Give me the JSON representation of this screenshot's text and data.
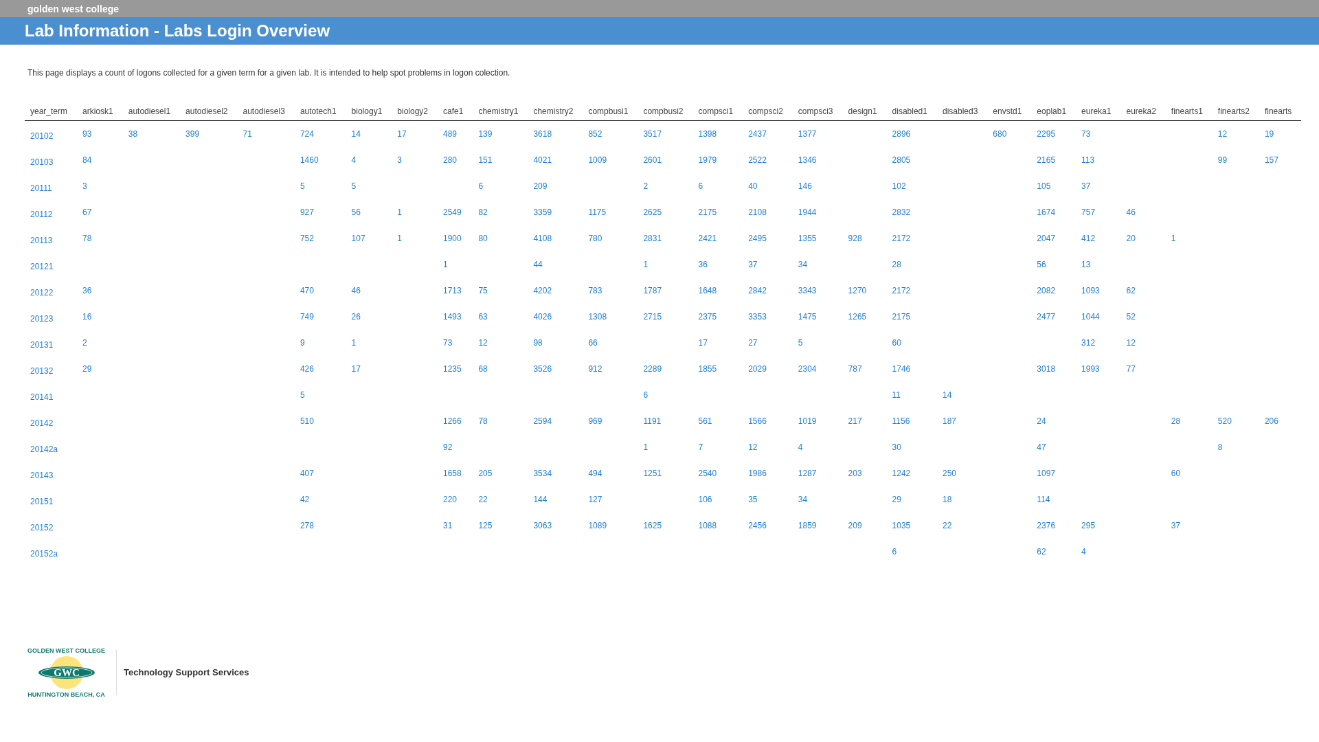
{
  "top_bar": {
    "site_name": "golden west college"
  },
  "header": {
    "title": "Lab Information - Labs Login Overview"
  },
  "intro": "This page displays a count of logons collected for a given term for a given lab. It is intended to help spot problems in logon colection.",
  "table": {
    "columns": [
      "year_term",
      "arkiosk1",
      "autodiesel1",
      "autodiesel2",
      "autodiesel3",
      "autotech1",
      "biology1",
      "biology2",
      "cafe1",
      "chemistry1",
      "chemistry2",
      "compbusi1",
      "compbusi2",
      "compsci1",
      "compsci2",
      "compsci3",
      "design1",
      "disabled1",
      "disabled3",
      "envstd1",
      "eoplab1",
      "eureka1",
      "eureka2",
      "finearts1",
      "finearts2",
      "finearts"
    ],
    "rows": [
      [
        "20102",
        "93",
        "38",
        "399",
        "71",
        "724",
        "14",
        "17",
        "489",
        "139",
        "3618",
        "852",
        "3517",
        "1398",
        "2437",
        "1377",
        null,
        "2896",
        null,
        "680",
        "2295",
        "73",
        null,
        null,
        "12",
        "19"
      ],
      [
        "20103",
        "84",
        null,
        null,
        null,
        "1460",
        "4",
        "3",
        "280",
        "151",
        "4021",
        "1009",
        "2601",
        "1979",
        "2522",
        "1346",
        null,
        "2805",
        null,
        null,
        "2165",
        "113",
        null,
        null,
        "99",
        "157"
      ],
      [
        "20111",
        "3",
        null,
        null,
        null,
        "5",
        "5",
        null,
        null,
        "6",
        "209",
        null,
        "2",
        "6",
        "40",
        "146",
        null,
        "102",
        null,
        null,
        "105",
        "37",
        null,
        null,
        null,
        null
      ],
      [
        "20112",
        "67",
        null,
        null,
        null,
        "927",
        "56",
        "1",
        "2549",
        "82",
        "3359",
        "1175",
        "2625",
        "2175",
        "2108",
        "1944",
        null,
        "2832",
        null,
        null,
        "1674",
        "757",
        "46",
        null,
        null,
        null
      ],
      [
        "20113",
        "78",
        null,
        null,
        null,
        "752",
        "107",
        "1",
        "1900",
        "80",
        "4108",
        "780",
        "2831",
        "2421",
        "2495",
        "1355",
        "928",
        "2172",
        null,
        null,
        "2047",
        "412",
        "20",
        "1",
        null,
        null
      ],
      [
        "20121",
        null,
        null,
        null,
        null,
        null,
        null,
        null,
        "1",
        null,
        "44",
        null,
        "1",
        "36",
        "37",
        "34",
        null,
        "28",
        null,
        null,
        "56",
        "13",
        null,
        null,
        null,
        null
      ],
      [
        "20122",
        "36",
        null,
        null,
        null,
        "470",
        "46",
        null,
        "1713",
        "75",
        "4202",
        "783",
        "1787",
        "1648",
        "2842",
        "3343",
        "1270",
        "2172",
        null,
        null,
        "2082",
        "1093",
        "62",
        null,
        null,
        null
      ],
      [
        "20123",
        "16",
        null,
        null,
        null,
        "749",
        "26",
        null,
        "1493",
        "63",
        "4026",
        "1308",
        "2715",
        "2375",
        "3353",
        "1475",
        "1265",
        "2175",
        null,
        null,
        "2477",
        "1044",
        "52",
        null,
        null,
        null
      ],
      [
        "20131",
        "2",
        null,
        null,
        null,
        "9",
        "1",
        null,
        "73",
        "12",
        "98",
        "66",
        null,
        "17",
        "27",
        "5",
        null,
        "60",
        null,
        null,
        null,
        "312",
        "12",
        null,
        null,
        null
      ],
      [
        "20132",
        "29",
        null,
        null,
        null,
        "426",
        "17",
        null,
        "1235",
        "68",
        "3526",
        "912",
        "2289",
        "1855",
        "2029",
        "2304",
        "787",
        "1746",
        null,
        null,
        "3018",
        "1993",
        "77",
        null,
        null,
        null
      ],
      [
        "20141",
        null,
        null,
        null,
        null,
        "5",
        null,
        null,
        null,
        null,
        null,
        null,
        "6",
        null,
        null,
        null,
        null,
        "11",
        "14",
        null,
        null,
        null,
        null,
        null,
        null,
        null
      ],
      [
        "20142",
        null,
        null,
        null,
        null,
        "510",
        null,
        null,
        "1266",
        "78",
        "2594",
        "969",
        "1191",
        "561",
        "1566",
        "1019",
        "217",
        "1156",
        "187",
        null,
        "24",
        null,
        null,
        "28",
        "520",
        "206"
      ],
      [
        "20142a",
        null,
        null,
        null,
        null,
        null,
        null,
        null,
        "92",
        null,
        null,
        null,
        "1",
        "7",
        "12",
        "4",
        null,
        "30",
        null,
        null,
        "47",
        null,
        null,
        null,
        "8",
        null
      ],
      [
        "20143",
        null,
        null,
        null,
        null,
        "407",
        null,
        null,
        "1658",
        "205",
        "3534",
        "494",
        "1251",
        "2540",
        "1986",
        "1287",
        "203",
        "1242",
        "250",
        null,
        "1097",
        null,
        null,
        "60",
        null,
        null
      ],
      [
        "20151",
        null,
        null,
        null,
        null,
        "42",
        null,
        null,
        "220",
        "22",
        "144",
        "127",
        null,
        "106",
        "35",
        "34",
        null,
        "29",
        "18",
        null,
        "114",
        null,
        null,
        null,
        null,
        null
      ],
      [
        "20152",
        null,
        null,
        null,
        null,
        "278",
        null,
        null,
        "31",
        "125",
        "3063",
        "1089",
        "1625",
        "1088",
        "2456",
        "1859",
        "209",
        "1035",
        "22",
        null,
        "2376",
        "295",
        null,
        "37",
        null,
        null
      ],
      [
        "20152a",
        null,
        null,
        null,
        null,
        null,
        null,
        null,
        null,
        null,
        null,
        null,
        null,
        null,
        null,
        null,
        null,
        "6",
        null,
        null,
        "62",
        "4",
        null,
        null,
        null,
        null
      ]
    ]
  },
  "footer": {
    "logo": {
      "top_text": "GOLDEN WEST COLLEGE",
      "initials": "GWC",
      "bottom_text": "HUNTINGTON BEACH, CA"
    },
    "department": "Technology Support Services"
  }
}
